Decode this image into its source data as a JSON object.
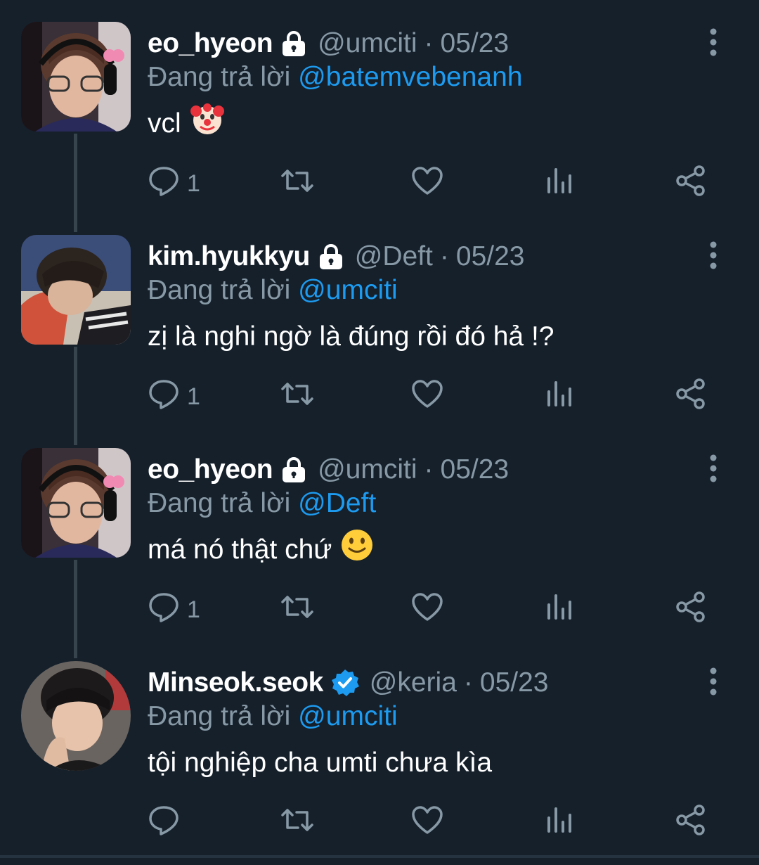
{
  "tweets": [
    {
      "name": "eo_hyeon",
      "handle": "@umciti",
      "date": "05/23",
      "reply_prefix": "Đang trả lời",
      "reply_to": "@batemvebenanh",
      "text": "vcl",
      "emoji": "clown-face",
      "badge": "lock-icon",
      "reply_count": "1"
    },
    {
      "name": "kim.hyukkyu",
      "handle": "@Deft",
      "date": "05/23",
      "reply_prefix": "Đang trả lời",
      "reply_to": "@umciti",
      "text": "zị là nghi ngờ là đúng rồi đó hả !?",
      "badge": "lock-icon",
      "reply_count": "1"
    },
    {
      "name": "eo_hyeon",
      "handle": "@umciti",
      "date": "05/23",
      "reply_prefix": "Đang trả lời",
      "reply_to": "@Deft",
      "text": "má nó thật chứ",
      "emoji": "slightly-smiling-face",
      "badge": "lock-icon",
      "reply_count": "1"
    },
    {
      "name": "Minseok.seok",
      "handle": "@keria",
      "date": "05/23",
      "reply_prefix": "Đang trả lời",
      "reply_to": "@umciti",
      "text": "tội nghiệp cha umti chưa kìa",
      "badge": "verified-icon",
      "reply_count": ""
    }
  ],
  "colors": {
    "background": "#15202b",
    "secondary_text": "#8899a6",
    "accent": "#1d9bf0",
    "thread_line": "#38444d"
  }
}
